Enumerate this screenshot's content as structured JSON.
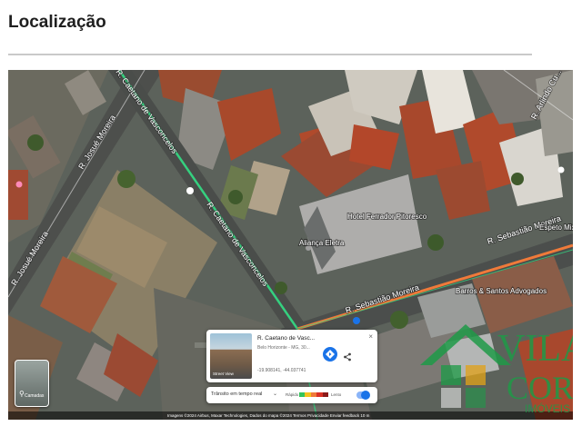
{
  "page": {
    "section_title": "Localização"
  },
  "map": {
    "streets": [
      "R. Caetano de Vasconcelos",
      "R. Sebastião Moreira",
      "R. Sebastião Moreira",
      "R. Josué Moreira",
      "R. Josué Moreira",
      "R. Arlindo Cu..."
    ],
    "pois": [
      "Aliança Eletra",
      "Hotel Ferrador Pitoresco",
      "Barros & Santos Advogados",
      "Espeto Mix"
    ],
    "footer": "Imagens ©2024 Airbus, Maxar Technologies, Dados do mapa ©2024   Termos   Privacidade   Enviar feedback   10 m",
    "streetview_label": "Camadas",
    "colors": {
      "main_road": "#35d07f",
      "highlight_road": "#f07a3a",
      "directions": "#1a73e8"
    }
  },
  "info_card": {
    "title": "R. Caetano de Vasc...",
    "subtitle": "Belo Horizonte - MG, 30...",
    "coords": "-19.908141, -44.037741",
    "thumb_label": "Street View",
    "close": "×",
    "directions_icon": "directions-icon",
    "share_icon": "share-icon"
  },
  "traffic": {
    "label": "Trânsito em tempo real",
    "chevron": "⌄",
    "fast": "Rápido",
    "slow": "Lento",
    "scale_colors": [
      "#35c45b",
      "#f5c21b",
      "#f07a3a",
      "#d93025",
      "#8b1a1a"
    ],
    "toggle_on": true
  },
  "watermark": {
    "line1": "VILA",
    "line2": "CORR",
    "line3": "IMÓVEIS"
  }
}
